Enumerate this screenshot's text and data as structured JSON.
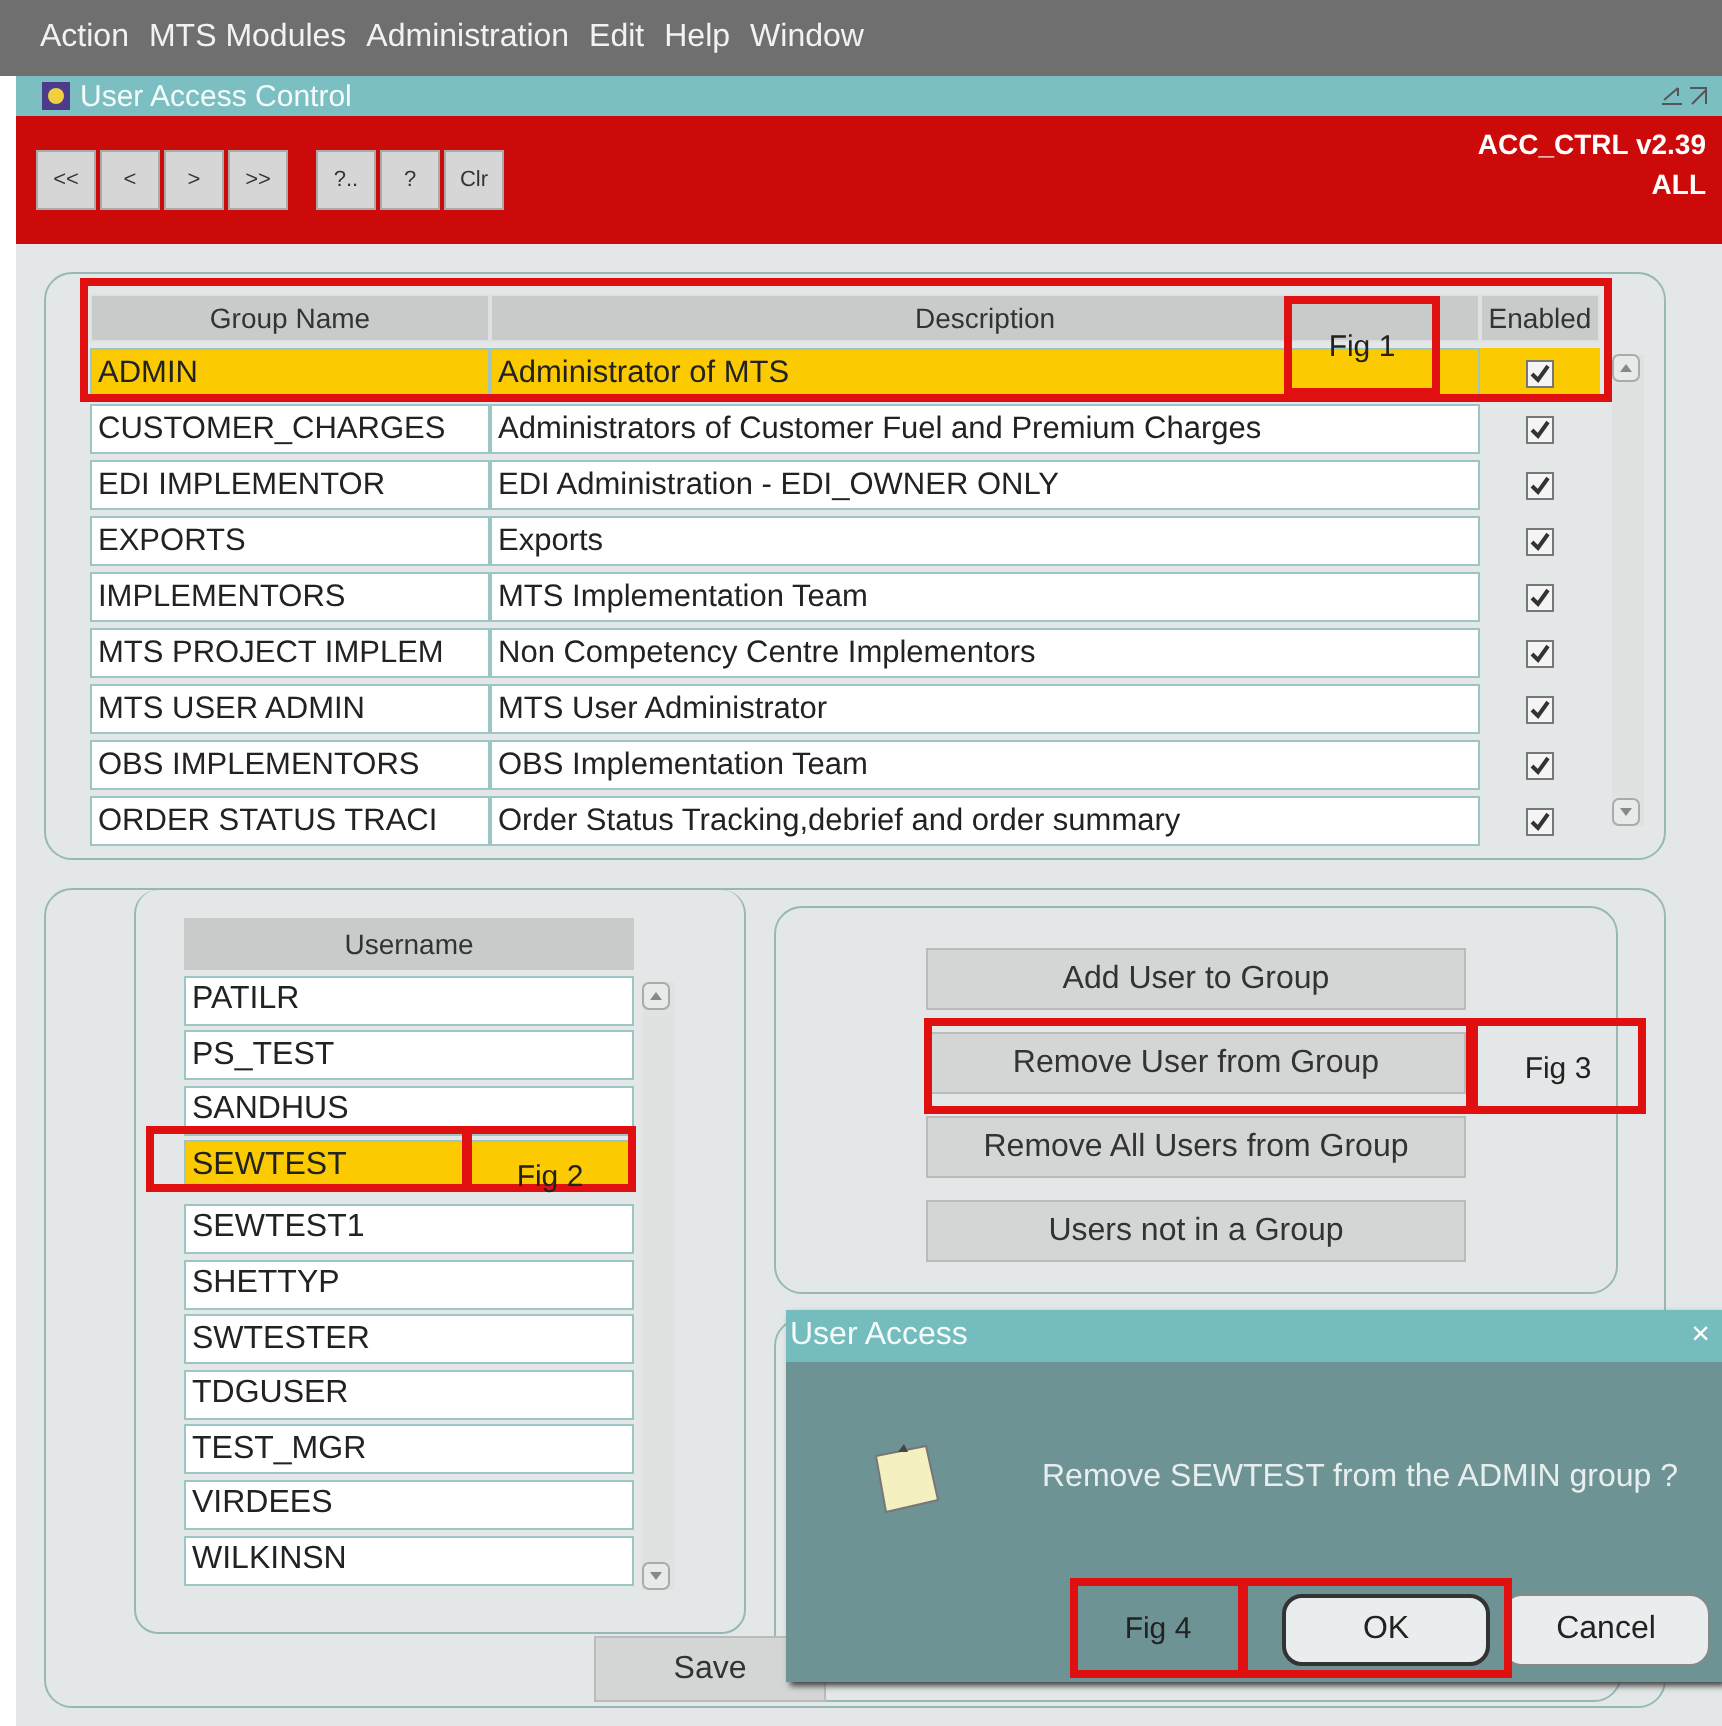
{
  "menu_bar": [
    "Action",
    "MTS Modules",
    "Administration",
    "Edit",
    "Help",
    "Window"
  ],
  "window": {
    "title": "User Access Control"
  },
  "toolbar": {
    "buttons": [
      "<<",
      "<",
      ">",
      ">>",
      "?..",
      "?",
      "Clr"
    ],
    "form_id": "ACC_CTRL v2.39",
    "scope": "ALL"
  },
  "groups": {
    "columns": [
      "Group Name",
      "Description",
      "Enabled"
    ],
    "rows": [
      {
        "name": "ADMIN",
        "description": "Administrator of MTS",
        "enabled": true,
        "selected": true
      },
      {
        "name": "CUSTOMER_CHARGES",
        "description": "Administrators of Customer Fuel and Premium Charges",
        "enabled": true,
        "selected": false
      },
      {
        "name": "EDI IMPLEMENTOR",
        "description": "EDI Administration - EDI_OWNER ONLY",
        "enabled": true,
        "selected": false
      },
      {
        "name": "EXPORTS",
        "description": "Exports",
        "enabled": true,
        "selected": false
      },
      {
        "name": "IMPLEMENTORS",
        "description": "MTS Implementation Team",
        "enabled": true,
        "selected": false
      },
      {
        "name": "MTS PROJECT IMPLEM",
        "description": "Non Competency Centre Implementors",
        "enabled": true,
        "selected": false
      },
      {
        "name": "MTS USER ADMIN",
        "description": "MTS User Administrator",
        "enabled": true,
        "selected": false
      },
      {
        "name": "OBS IMPLEMENTORS",
        "description": "OBS Implementation Team",
        "enabled": true,
        "selected": false
      },
      {
        "name": "ORDER STATUS TRACI",
        "description": "Order Status Tracking,debrief and order summary",
        "enabled": true,
        "selected": false
      }
    ]
  },
  "users": {
    "column": "Username",
    "rows": [
      {
        "name": "PATILR",
        "selected": false
      },
      {
        "name": "PS_TEST",
        "selected": false
      },
      {
        "name": "SANDHUS",
        "selected": false
      },
      {
        "name": "SEWTEST",
        "selected": true
      },
      {
        "name": "SEWTEST1",
        "selected": false
      },
      {
        "name": "SHETTYP",
        "selected": false
      },
      {
        "name": "SWTESTER",
        "selected": false
      },
      {
        "name": "TDGUSER",
        "selected": false
      },
      {
        "name": "TEST_MGR",
        "selected": false
      },
      {
        "name": "VIRDEES",
        "selected": false
      },
      {
        "name": "WILKINSN",
        "selected": false
      }
    ]
  },
  "actions": [
    "Add User to Group",
    "Remove User from Group",
    "Remove All Users from Group",
    "Users not in a Group"
  ],
  "save_button": "Save",
  "dialog": {
    "title": "User Access",
    "close": "×",
    "message": "Remove SEWTEST from the ADMIN group ?",
    "buttons": [
      "OK",
      "Cancel"
    ]
  },
  "annotations": [
    {
      "label": "Fig 1"
    },
    {
      "label": "Fig 2"
    },
    {
      "label": "Fig 3"
    },
    {
      "label": "Fig 4"
    }
  ]
}
